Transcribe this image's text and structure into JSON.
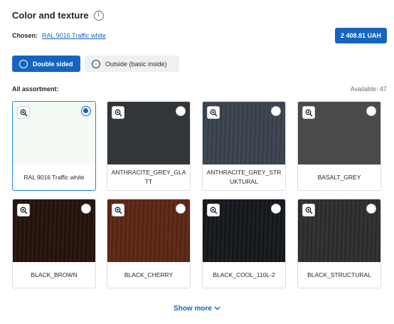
{
  "header": {
    "title": "Color and texture",
    "info_icon": "info-icon"
  },
  "chosen": {
    "label": "Chosen:",
    "value": "RAL 9016 Traffic white"
  },
  "price": "2 408.81 UAH",
  "toggles": [
    {
      "label": "Double sided",
      "selected": true
    },
    {
      "label": "Outside (basic inside)",
      "selected": false
    }
  ],
  "assortment": {
    "label": "All assortment:",
    "available": "Available: 47"
  },
  "colors": {
    "accent": "#1565c0",
    "selected_border": "#1e88e5"
  },
  "cards": [
    {
      "name": "RAL 9016 Traffic white",
      "color": "#f4fbf4",
      "selected": true,
      "texture": "none"
    },
    {
      "name": "ANTHRACITE_GREY_GLATT",
      "color": "#333639",
      "selected": false,
      "texture": "none"
    },
    {
      "name": "ANTHRACITE_GREY_STRUKTURAL",
      "color": "#39424d",
      "selected": false,
      "texture": "wood"
    },
    {
      "name": "BASALT_GREY",
      "color": "#4c4a48",
      "selected": false,
      "texture": "none"
    },
    {
      "name": "BLACK_BROWN",
      "color": "#24120c",
      "selected": false,
      "texture": "wood"
    },
    {
      "name": "BLACK_CHERRY",
      "color": "#5a2614",
      "selected": false,
      "texture": "wood"
    },
    {
      "name": "BLACK_COOL_110L-2",
      "color": "#14171b",
      "selected": false,
      "texture": "wood"
    },
    {
      "name": "BLACK_STRUCTURAL",
      "color": "#2c2d2e",
      "selected": false,
      "texture": "wood"
    }
  ],
  "show_more": "Show more"
}
